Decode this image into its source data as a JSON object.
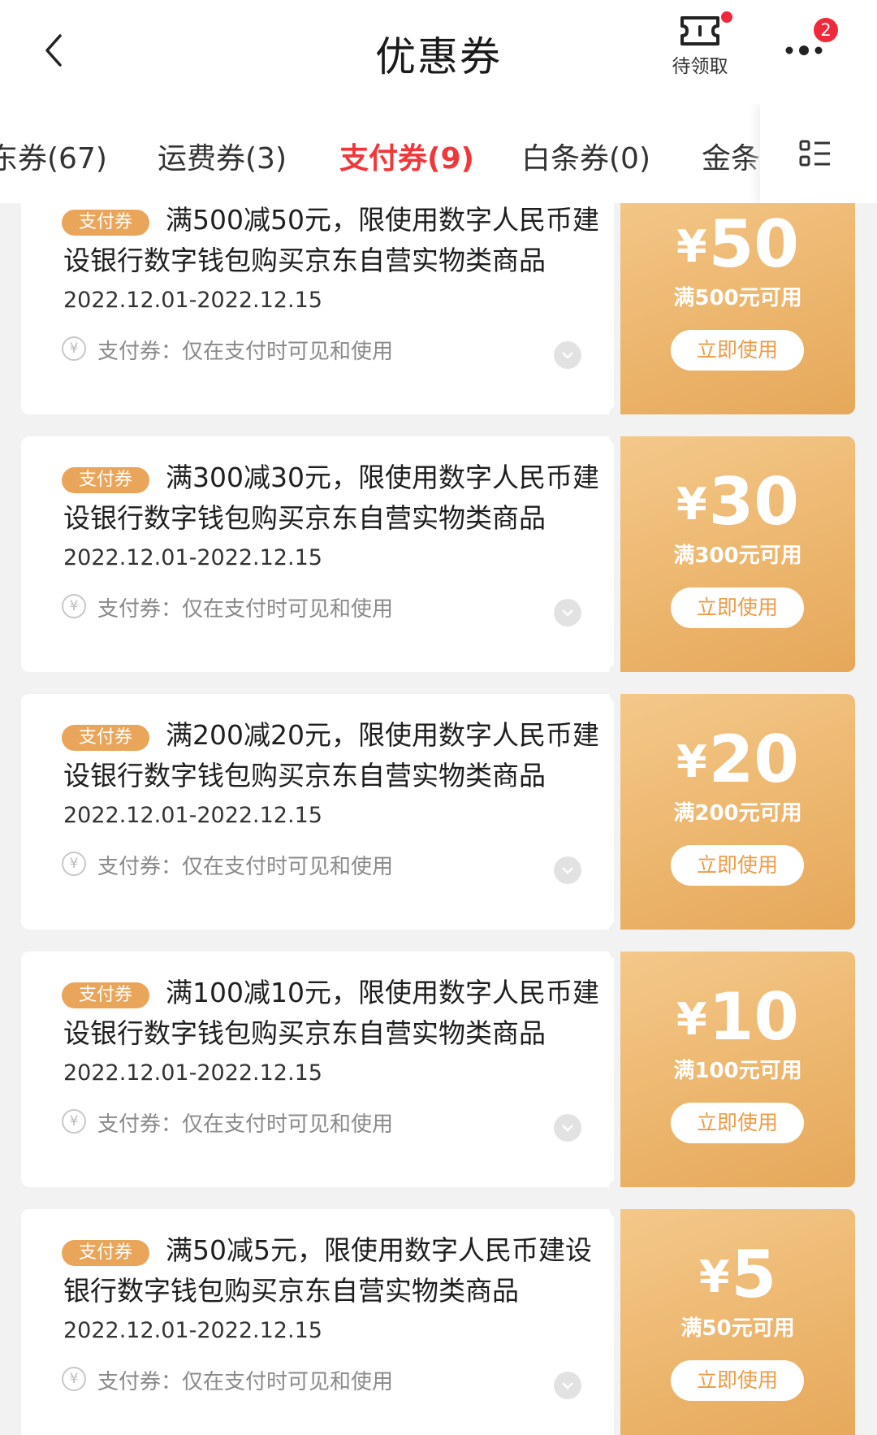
{
  "header": {
    "title": "优惠券",
    "pending_label": "待领取",
    "more_badge": "2"
  },
  "tabs": [
    {
      "label": "东券(67)"
    },
    {
      "label": "运费券(3)"
    },
    {
      "label": "支付券(9)",
      "active": true
    },
    {
      "label": "白条券(0)"
    },
    {
      "label": "金条券"
    }
  ],
  "coupons": [
    {
      "tag": "支付券",
      "title": "满500减50元，限使用数字人民币建设银行数字钱包购买京东自营实物类商品",
      "date": "2022.12.01-2022.12.15",
      "note": "支付券：仅在支付时可见和使用",
      "currency": "¥",
      "amount": "50",
      "condition": "满500元可用",
      "button": "立即使用"
    },
    {
      "tag": "支付券",
      "title": "满300减30元，限使用数字人民币建设银行数字钱包购买京东自营实物类商品",
      "date": "2022.12.01-2022.12.15",
      "note": "支付券：仅在支付时可见和使用",
      "currency": "¥",
      "amount": "30",
      "condition": "满300元可用",
      "button": "立即使用"
    },
    {
      "tag": "支付券",
      "title": "满200减20元，限使用数字人民币建设银行数字钱包购买京东自营实物类商品",
      "date": "2022.12.01-2022.12.15",
      "note": "支付券：仅在支付时可见和使用",
      "currency": "¥",
      "amount": "20",
      "condition": "满200元可用",
      "button": "立即使用"
    },
    {
      "tag": "支付券",
      "title": "满100减10元，限使用数字人民币建设银行数字钱包购买京东自营实物类商品",
      "date": "2022.12.01-2022.12.15",
      "note": "支付券：仅在支付时可见和使用",
      "currency": "¥",
      "amount": "10",
      "condition": "满100元可用",
      "button": "立即使用"
    },
    {
      "tag": "支付券",
      "title": "满50减5元，限使用数字人民币建设银行数字钱包购买京东自营实物类商品",
      "date": "2022.12.01-2022.12.15",
      "note": "支付券：仅在支付时可见和使用",
      "currency": "¥",
      "amount": "5",
      "condition": "满50元可用",
      "button": "立即使用"
    }
  ],
  "colors": {
    "accent": "#f2373a",
    "coupon_gold": "#ecb66e",
    "tag_bg": "#e9a55a",
    "badge_red": "#f0283c"
  },
  "icons": {
    "back": "chevron-left-icon",
    "pending": "ticket-icon",
    "more": "more-dots-icon",
    "grid": "category-grid-icon",
    "yuan": "yuan-circle-icon",
    "expand": "chevron-down-icon"
  }
}
